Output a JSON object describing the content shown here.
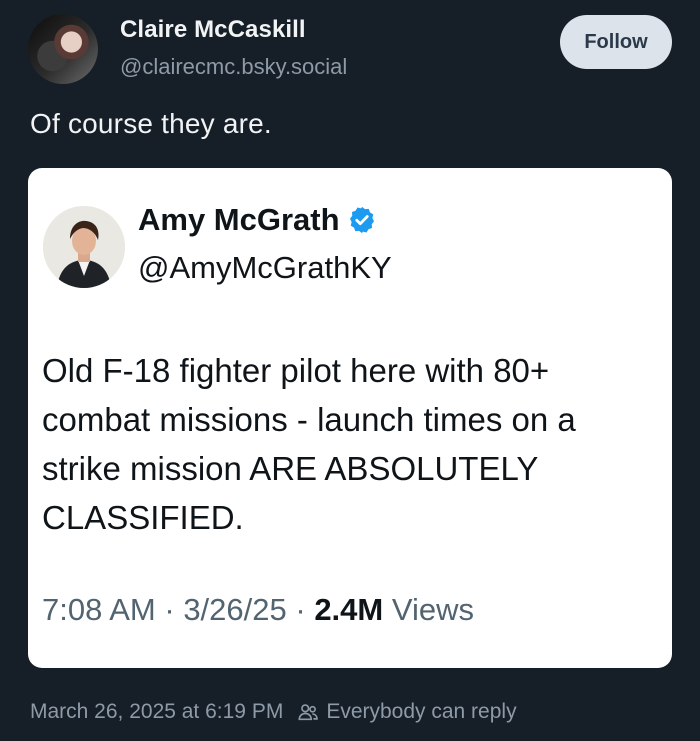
{
  "post": {
    "author_name": "Claire McCaskill",
    "author_handle": "@clairecmc.bsky.social",
    "follow_label": "Follow",
    "text": "Of course they are.",
    "timestamp": "March 26, 2025 at 6:19 PM",
    "reply_setting": "Everybody can reply"
  },
  "embed": {
    "author_name": "Amy McGrath",
    "author_handle": "@AmyMcGrathKY",
    "verified_icon": "verified-badge-icon",
    "body": "Old F-18 fighter pilot here with 80+\ncombat missions - launch times  on a\nstrike mission ARE ABSOLUTELY\nCLASSIFIED.",
    "time": "7:08 AM",
    "date": "3/26/25",
    "views_count": "2.4M",
    "views_label": "Views"
  },
  "colors": {
    "background": "#161e27",
    "verified_blue": "#1d9bf0",
    "follow_button": "#dde3ea"
  }
}
